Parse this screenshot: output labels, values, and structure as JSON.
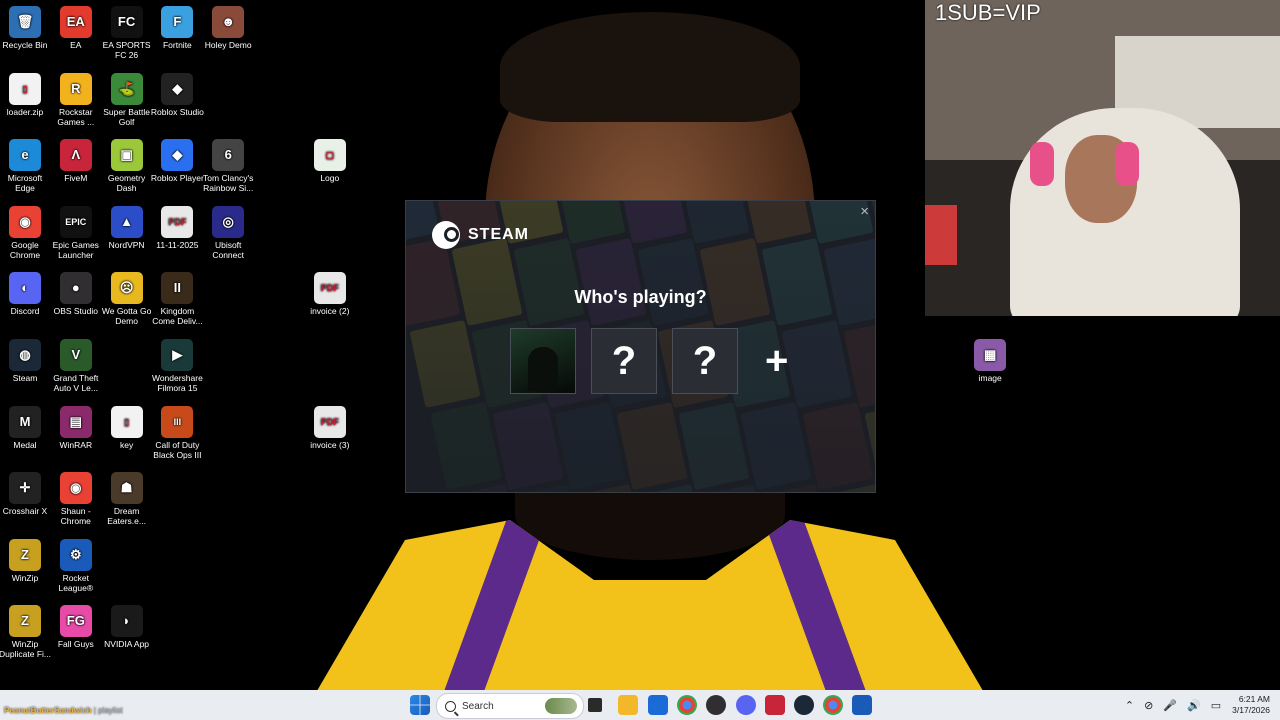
{
  "desktop": {
    "icons": [
      {
        "label": "Recycle Bin",
        "glyph": "🗑",
        "icon": "recycle-bin-icon",
        "color": "#2d6fb5"
      },
      {
        "label": "EA",
        "glyph": "EA",
        "icon": "ea-icon",
        "color": "#e23b2e"
      },
      {
        "label": "EA SPORTS FC 26",
        "glyph": "FC",
        "icon": "ea-fc-icon",
        "color": "#111111"
      },
      {
        "label": "Fortnite",
        "glyph": "F",
        "icon": "fortnite-icon",
        "color": "#3aa0e0"
      },
      {
        "label": "Holey Demo",
        "glyph": "☻",
        "icon": "holey-demo-icon",
        "color": "#8a4a3a"
      },
      {
        "label": "loader.zip",
        "glyph": "▯",
        "icon": "zip-file-icon",
        "color": "#f2f2f2"
      },
      {
        "label": "Rockstar Games ...",
        "glyph": "R",
        "icon": "rockstar-icon",
        "color": "#f2b21e"
      },
      {
        "label": "Super Battle Golf",
        "glyph": "⛳",
        "icon": "golf-icon",
        "color": "#3a8a3a"
      },
      {
        "label": "Roblox Studio",
        "glyph": "◆",
        "icon": "roblox-studio-icon",
        "color": "#222222"
      },
      {
        "label": "Microsoft Edge",
        "glyph": "e",
        "icon": "edge-icon",
        "color": "#1d8ad8"
      },
      {
        "label": "FiveM",
        "glyph": "Λ",
        "icon": "fivem-icon",
        "color": "#c8243a"
      },
      {
        "label": "Geometry Dash",
        "glyph": "▣",
        "icon": "geometry-dash-icon",
        "color": "#9ac83a"
      },
      {
        "label": "Roblox Player",
        "glyph": "◆",
        "icon": "roblox-player-icon",
        "color": "#2a6ff0"
      },
      {
        "label": "Tom Clancy's Rainbow Si...",
        "glyph": "6",
        "icon": "rainbow-six-icon",
        "color": "#444444"
      },
      {
        "label": "Logo",
        "glyph": "▢",
        "icon": "logo-file-icon",
        "color": "#e8f0e8"
      },
      {
        "label": "Google Chrome",
        "glyph": "◉",
        "icon": "chrome-icon",
        "color": "#e94235"
      },
      {
        "label": "Epic Games Launcher",
        "glyph": "EPIC",
        "icon": "epic-games-icon",
        "color": "#111111"
      },
      {
        "label": "NordVPN",
        "glyph": "▲",
        "icon": "nordvpn-icon",
        "color": "#2b4dc8"
      },
      {
        "label": "11-11-2025",
        "glyph": "PDF",
        "icon": "pdf-file-icon",
        "color": "#e8e8e8"
      },
      {
        "label": "Ubisoft Connect",
        "glyph": "◎",
        "icon": "ubisoft-icon",
        "color": "#2a2a8a"
      },
      {
        "label": "Discord",
        "glyph": "◐",
        "icon": "discord-icon",
        "color": "#5865f2"
      },
      {
        "label": "OBS Studio",
        "glyph": "●",
        "icon": "obs-icon",
        "color": "#302e31"
      },
      {
        "label": "We Gotta Go Demo",
        "glyph": "☹",
        "icon": "we-gotta-go-icon",
        "color": "#e8b820"
      },
      {
        "label": "Kingdom Come Deliv...",
        "glyph": "II",
        "icon": "kingdom-come-icon",
        "color": "#3a2a1a"
      },
      {
        "label": "invoice (2)",
        "glyph": "PDF",
        "icon": "pdf-file-icon",
        "color": "#e8e8e8"
      },
      {
        "label": "Steam",
        "glyph": "◍",
        "icon": "steam-icon",
        "color": "#1b2838"
      },
      {
        "label": "Grand Theft Auto V Le...",
        "glyph": "V",
        "icon": "gta-v-icon",
        "color": "#2a5a2a"
      },
      {
        "label": "Wondershare Filmora 15",
        "glyph": "▶",
        "icon": "filmora-icon",
        "color": "#1a3a3a"
      },
      {
        "label": "Medal",
        "glyph": "M",
        "icon": "medal-icon",
        "color": "#222222"
      },
      {
        "label": "WinRAR",
        "glyph": "▤",
        "icon": "winrar-icon",
        "color": "#8a2a6a"
      },
      {
        "label": "key",
        "glyph": "▯",
        "icon": "text-file-icon",
        "color": "#f2f2f2"
      },
      {
        "label": "Call of Duty Black Ops III",
        "glyph": "III",
        "icon": "cod-icon",
        "color": "#c84a1a"
      },
      {
        "label": "invoice (3)",
        "glyph": "PDF",
        "icon": "pdf-file-icon",
        "color": "#e8e8e8"
      },
      {
        "label": "Crosshair X",
        "glyph": "✛",
        "icon": "crosshair-x-icon",
        "color": "#222222"
      },
      {
        "label": "Shaun - Chrome",
        "glyph": "◉",
        "icon": "chrome-profile-icon",
        "color": "#e94235"
      },
      {
        "label": "Dream Eaters.e...",
        "glyph": "☗",
        "icon": "dream-eaters-icon",
        "color": "#4a3a2a"
      },
      {
        "label": "WinZip",
        "glyph": "Z",
        "icon": "winzip-icon",
        "color": "#c8a020"
      },
      {
        "label": "Rocket League®",
        "glyph": "⚙",
        "icon": "rocket-league-icon",
        "color": "#1a5ab8"
      },
      {
        "label": "WinZip Duplicate Fi...",
        "glyph": "Z",
        "icon": "winzip-duplicate-icon",
        "color": "#c8a020"
      },
      {
        "label": "Fall Guys",
        "glyph": "FG",
        "icon": "fall-guys-icon",
        "color": "#e84aa8"
      },
      {
        "label": "NVIDIA App",
        "glyph": "◗",
        "icon": "nvidia-icon",
        "color": "#1a1a1a"
      },
      {
        "label": "image",
        "glyph": "▦",
        "icon": "image-file-icon",
        "color": "#8a5aa8"
      }
    ]
  },
  "steam": {
    "brand": "STEAM",
    "heading": "Who's playing?",
    "close_glyph": "×",
    "unknown_glyph": "?",
    "add_glyph": "+"
  },
  "webcam": {
    "overlay_text": "1SUB=VIP"
  },
  "taskbar": {
    "search_label": "Search",
    "time": "6:21 AM",
    "date": "3/17/2026",
    "tray_glyphs": [
      "⌃",
      "⊘",
      "🎤",
      "🔊",
      "▭"
    ]
  },
  "stream_label": {
    "name": "PeanutButterSandwich",
    "suffix": " | playlist"
  },
  "colors": {
    "steam_bg": "#1b1e24",
    "taskbar_bg": "#e9edf2",
    "jersey_gold": "#f2c21a",
    "jersey_purple": "#5b2a8a"
  }
}
